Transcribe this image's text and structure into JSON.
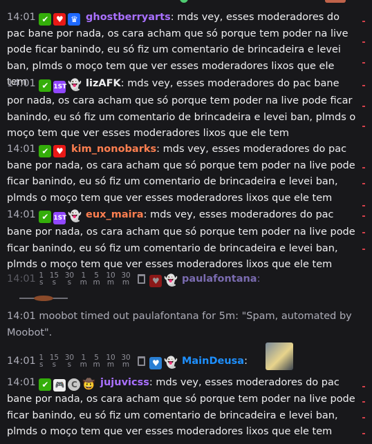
{
  "chat": {
    "colors": {
      "background": "#18181b",
      "text": "#efeff1",
      "timestamp": "#adadb8",
      "deleted_user": "#7a6bb0",
      "mod_badge": "#34ae0a",
      "sub_badge": "#e91916"
    },
    "spam_text": "mds vey, esses moderadores do pac bane por nada, os cara acham que só porque tem poder na live pode ficar banindo, eu só fiz um comentario de brincadeira e levei ban, plmds o moço tem que ver esses moderadores lixos que ele tem",
    "messages": [
      {
        "time": "14:01",
        "user": "ghostberryarts",
        "color": "#a970ff",
        "sep": ": "
      },
      {
        "time": "14:01",
        "user": "lizAFK",
        "color": "#efeff1",
        "sep": ": "
      },
      {
        "time": "14:01",
        "user": "kim_nonobarks",
        "color": "#ff7f50",
        "sep": ": "
      },
      {
        "time": "14:01",
        "user": "eux_maira",
        "color": "#ff7f50",
        "sep": ": "
      },
      {
        "time": "14:01",
        "user": "jujuvicss",
        "color": "#a970ff",
        "sep": ": "
      }
    ],
    "deleted": {
      "time": "14:01",
      "user": "paulafontana",
      "sep": ":"
    },
    "timeout_time": "14:01",
    "timeout_text": "moobot timed out paulafontana for 5m: \"Spam, automated by Moobot\".",
    "maindeusa": {
      "time": "14:01",
      "user": "MainDeusa",
      "sep": ":"
    },
    "mod_actions": [
      {
        "top": "1",
        "bottom": "s"
      },
      {
        "top": "15",
        "bottom": "s"
      },
      {
        "top": "30",
        "bottom": "s"
      },
      {
        "top": "1",
        "bottom": "m"
      },
      {
        "top": "5",
        "bottom": "m"
      },
      {
        "top": "10",
        "bottom": "m"
      },
      {
        "top": "30",
        "bottom": "m"
      }
    ]
  }
}
